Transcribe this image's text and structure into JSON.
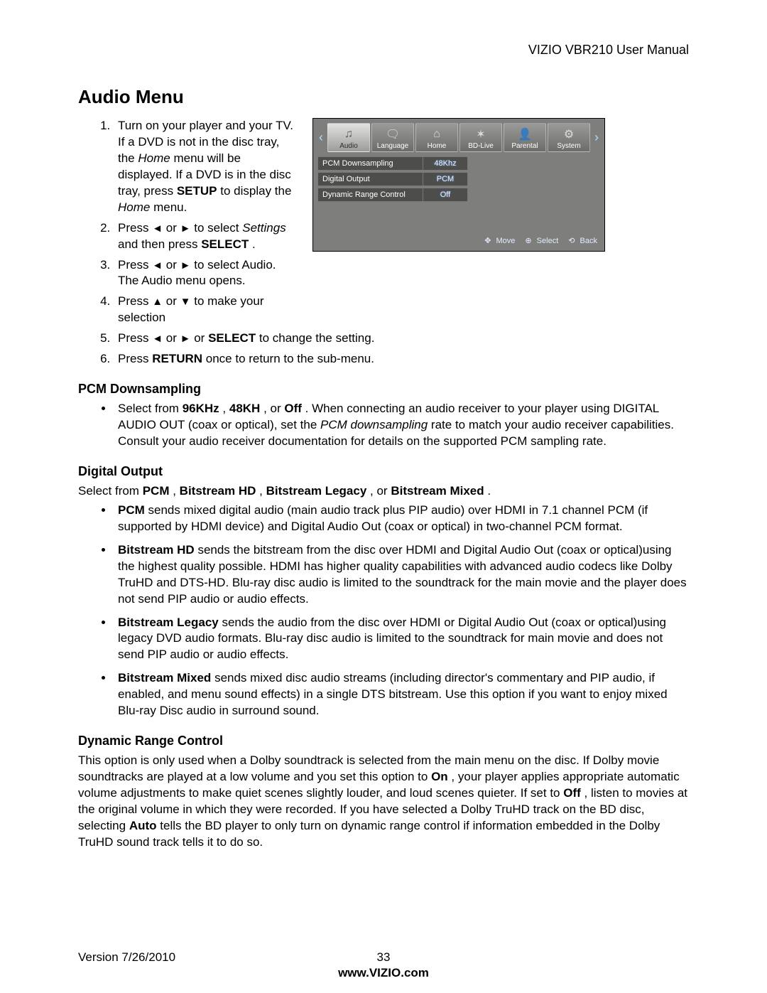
{
  "header": {
    "title": "VIZIO VBR210 User Manual"
  },
  "title": "Audio Menu",
  "steps": {
    "s1a": "Turn on your player and your TV. If a DVD is not in the disc tray, the ",
    "s1b_home_i": "Home",
    "s1c": " menu will be displayed. If a DVD is in the disc tray, press ",
    "s1d_setup_b": "SETUP",
    "s1e": " to display the ",
    "s1f_home_i": "Home",
    "s1g": " menu.",
    "s2a": "Press ",
    "s2b": " or ",
    "s2c": " to select ",
    "s2d_settings_i": "Settings",
    "s2e": " and then press ",
    "s2f_select_b": "SELECT",
    "s2g": ".",
    "s3a": "Press ",
    "s3b": " or ",
    "s3c": " to select Audio. The Audio menu opens.",
    "s4a": "Press ",
    "s4b": " or ",
    "s4c": " to make your selection",
    "s5a": "Press ",
    "s5b": " or ",
    "s5c": " or ",
    "s5d_select_b": "SELECT",
    "s5e": " to change the setting.",
    "s6a": "Press ",
    "s6b_return_b": "RETURN",
    "s6c": " once to return to the sub-menu."
  },
  "arrows": {
    "left": "◄",
    "right": "►",
    "up": "▲",
    "down": "▼"
  },
  "pcm": {
    "heading": "PCM Downsampling",
    "b1a": "Select from ",
    "b1b_96_b": "96KHz",
    "b1c": ", ",
    "b1d_48_b": "48KH",
    "b1e": ", or ",
    "b1f_off_b": "Off",
    "b1g": ". When connecting an audio receiver to your player using DIGITAL AUDIO OUT (coax or optical), set the ",
    "b1h_pcmi": "PCM downsampling",
    "b1i": " rate to match your audio receiver capabilities. Consult your audio receiver documentation for details on the supported PCM sampling rate."
  },
  "dig": {
    "heading": "Digital Output",
    "intro_a": "Select from ",
    "intro_pcm_b": "PCM",
    "intro_c": ", ",
    "intro_bhd_b": "Bitstream HD",
    "intro_e": ", ",
    "intro_bleg_b": "Bitstream Legacy",
    "intro_g": ", or ",
    "intro_bmx_b": "Bitstream Mixed",
    "intro_i": ".",
    "li1_a": "PCM",
    "li1_b": " sends mixed digital audio (main audio track plus PIP audio) over HDMI in 7.1 channel PCM (if supported by HDMI device) and Digital Audio Out (coax or optical) in two-channel PCM format.",
    "li2_a": "Bitstream HD",
    "li2_b": " sends the bitstream from the disc over HDMI and Digital Audio Out (coax or optical)using the highest quality possible. HDMI has higher quality capabilities with advanced audio codecs like Dolby TruHD and DTS-HD. Blu-ray disc audio is limited to the soundtrack for the main movie and the player does not send PIP audio or audio effects.",
    "li3_a": "Bitstream Legacy",
    "li3_b": " sends the audio from the disc over HDMI or Digital Audio Out (coax or optical)using legacy DVD audio formats. Blu-ray disc audio is limited to the soundtrack for main movie and does not send PIP audio or audio effects.",
    "li4_a": "Bitstream Mixed",
    "li4_b": " sends mixed disc audio streams (including director's commentary and PIP audio, if enabled, and menu sound effects) in a single DTS bitstream. Use this option if you want to enjoy mixed Blu-ray Disc audio in surround sound."
  },
  "drc": {
    "heading": "Dynamic Range Control",
    "p1": "This option is only used when a Dolby soundtrack is selected from the main menu on the disc. If Dolby movie soundtracks are played at a low volume and you set this option to ",
    "on_b": "On",
    "p2": ", your player applies appropriate automatic volume adjustments to make quiet scenes slightly louder, and loud scenes quieter. If set to ",
    "off_b": "Off",
    "p3": ", listen to movies at the original volume in which they were recorded. If you have selected a Dolby TruHD track on the BD disc, selecting ",
    "auto_b": "Auto",
    "p4": " tells the BD player to only turn on dynamic range control if information embedded in the Dolby TruHD sound track tells it to do so."
  },
  "osd": {
    "tabs": [
      "Audio",
      "Language",
      "Home",
      "BD-Live",
      "Parental",
      "System"
    ],
    "icons": [
      "♫",
      "🗨",
      "⌂",
      "✶",
      "👤",
      "⚙"
    ],
    "rows": [
      {
        "label": "PCM Downsampling",
        "value": "48Khz"
      },
      {
        "label": "Digital Output",
        "value": "PCM"
      },
      {
        "label": "Dynamic Range Control",
        "value": "Off"
      }
    ],
    "hints": [
      {
        "sym": "✥",
        "label": "Move"
      },
      {
        "sym": "⊕",
        "label": "Select"
      },
      {
        "sym": "⟲",
        "label": "Back"
      }
    ],
    "arrow_left": "‹",
    "arrow_right": "›"
  },
  "footer": {
    "version": "Version 7/26/2010",
    "page": "33",
    "url": "www.VIZIO.com"
  }
}
